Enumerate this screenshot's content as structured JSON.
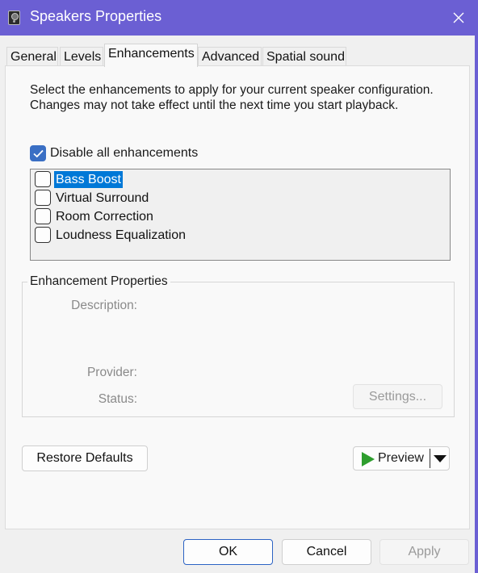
{
  "window": {
    "title": "Speakers Properties",
    "app_icon": "speaker-icon",
    "close_icon": "close-icon"
  },
  "tabs": [
    {
      "label": "General",
      "active": false
    },
    {
      "label": "Levels",
      "active": false
    },
    {
      "label": "Enhancements",
      "active": true
    },
    {
      "label": "Advanced",
      "active": false
    },
    {
      "label": "Spatial sound",
      "active": false
    }
  ],
  "enhancements": {
    "intro": "Select the enhancements to apply for your current speaker configuration. Changes may not take effect until the next time you start playback.",
    "disable_all_label": "Disable all enhancements",
    "disable_all_checked": true,
    "items": [
      {
        "label": "Bass Boost",
        "checked": false,
        "selected": true
      },
      {
        "label": "Virtual Surround",
        "checked": false,
        "selected": false
      },
      {
        "label": "Room Correction",
        "checked": false,
        "selected": false
      },
      {
        "label": "Loudness Equalization",
        "checked": false,
        "selected": false
      }
    ]
  },
  "properties": {
    "group_title": "Enhancement Properties",
    "description_label": "Description:",
    "provider_label": "Provider:",
    "status_label": "Status:",
    "settings_button": "Settings..."
  },
  "actions": {
    "restore_defaults": "Restore Defaults",
    "preview": "Preview",
    "preview_icon": "play-icon",
    "preview_dropdown_icon": "chevron-down-icon"
  },
  "footer": {
    "ok": "OK",
    "cancel": "Cancel",
    "apply": "Apply"
  },
  "colors": {
    "title_bar": "#6b5fd3",
    "accent": "#3a6fc4",
    "selection": "#0078d7",
    "play_green": "#2e9e2e"
  }
}
